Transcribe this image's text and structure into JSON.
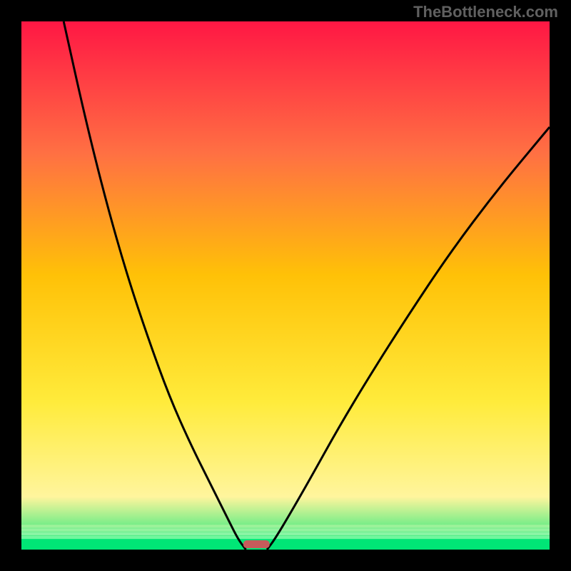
{
  "watermark": "TheBottleneck.com",
  "chart_data": {
    "type": "line",
    "title": "",
    "xlabel": "",
    "ylabel": "",
    "xlim": [
      0,
      100
    ],
    "ylim": [
      0,
      100
    ],
    "gradient_colors": {
      "top": "#FF1744",
      "upper_mid": "#FF7043",
      "mid": "#FFC107",
      "lower_mid": "#FFEB3B",
      "lower": "#FFF59D",
      "bottom": "#00E676"
    },
    "series": [
      {
        "name": "left-curve",
        "x": [
          8,
          12,
          16,
          20,
          24,
          28,
          32,
          36,
          39,
          41,
          42.5
        ],
        "y": [
          100,
          82,
          66,
          52,
          40,
          29,
          20,
          12,
          6,
          2,
          0
        ]
      },
      {
        "name": "right-curve",
        "x": [
          46.5,
          48,
          51,
          55,
          60,
          66,
          73,
          81,
          90,
          100
        ],
        "y": [
          0,
          2,
          7,
          14,
          23,
          33,
          44,
          56,
          68,
          80
        ]
      }
    ],
    "marker": {
      "x_start": 42,
      "x_end": 47,
      "y": 0.5,
      "color": "#C65B5B"
    },
    "bottom_bands": [
      {
        "y": 95.3,
        "height": 0.6,
        "color": "rgba(255,255,200,0.3)"
      },
      {
        "y": 96,
        "height": 0.6,
        "color": "rgba(230,255,200,0.4)"
      },
      {
        "y": 96.7,
        "height": 0.6,
        "color": "rgba(200,255,200,0.5)"
      },
      {
        "y": 97.4,
        "height": 0.6,
        "color": "rgba(150,255,180,0.6)"
      },
      {
        "y": 98,
        "height": 2,
        "color": "#00E676"
      }
    ]
  }
}
